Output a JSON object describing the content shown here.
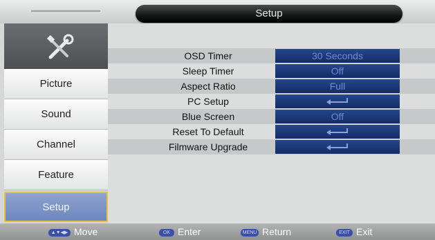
{
  "header": {
    "title": "Setup"
  },
  "sidebar": {
    "tool_icon": "tools-icon",
    "items": [
      {
        "label": "Picture"
      },
      {
        "label": "Sound"
      },
      {
        "label": "Channel"
      },
      {
        "label": "Feature"
      },
      {
        "label": "Setup",
        "selected": true
      }
    ]
  },
  "settings": [
    {
      "label": "OSD Timer",
      "value": "30 Seconds"
    },
    {
      "label": "Sleep Timer",
      "value": "Off"
    },
    {
      "label": "Aspect Ratio",
      "value": "Full"
    },
    {
      "label": "PC Setup",
      "value_icon": "enter-arrow-icon"
    },
    {
      "label": "Blue Screen",
      "value": "Off"
    },
    {
      "label": "Reset To Default",
      "value_icon": "enter-arrow-icon"
    },
    {
      "label": "Filmware Upgrade",
      "value_icon": "enter-arrow-icon"
    }
  ],
  "footer": {
    "move": {
      "key": "▲▼◀▶",
      "label": "Move"
    },
    "enter": {
      "key": "OK",
      "label": "Enter"
    },
    "return": {
      "key": "MENU",
      "label": "Return"
    },
    "exit": {
      "key": "EXIT",
      "label": "Exit"
    }
  },
  "colors": {
    "value_box": "#1d3a7a",
    "selected_item": "#7d93c6",
    "selected_border": "#e6c441"
  }
}
